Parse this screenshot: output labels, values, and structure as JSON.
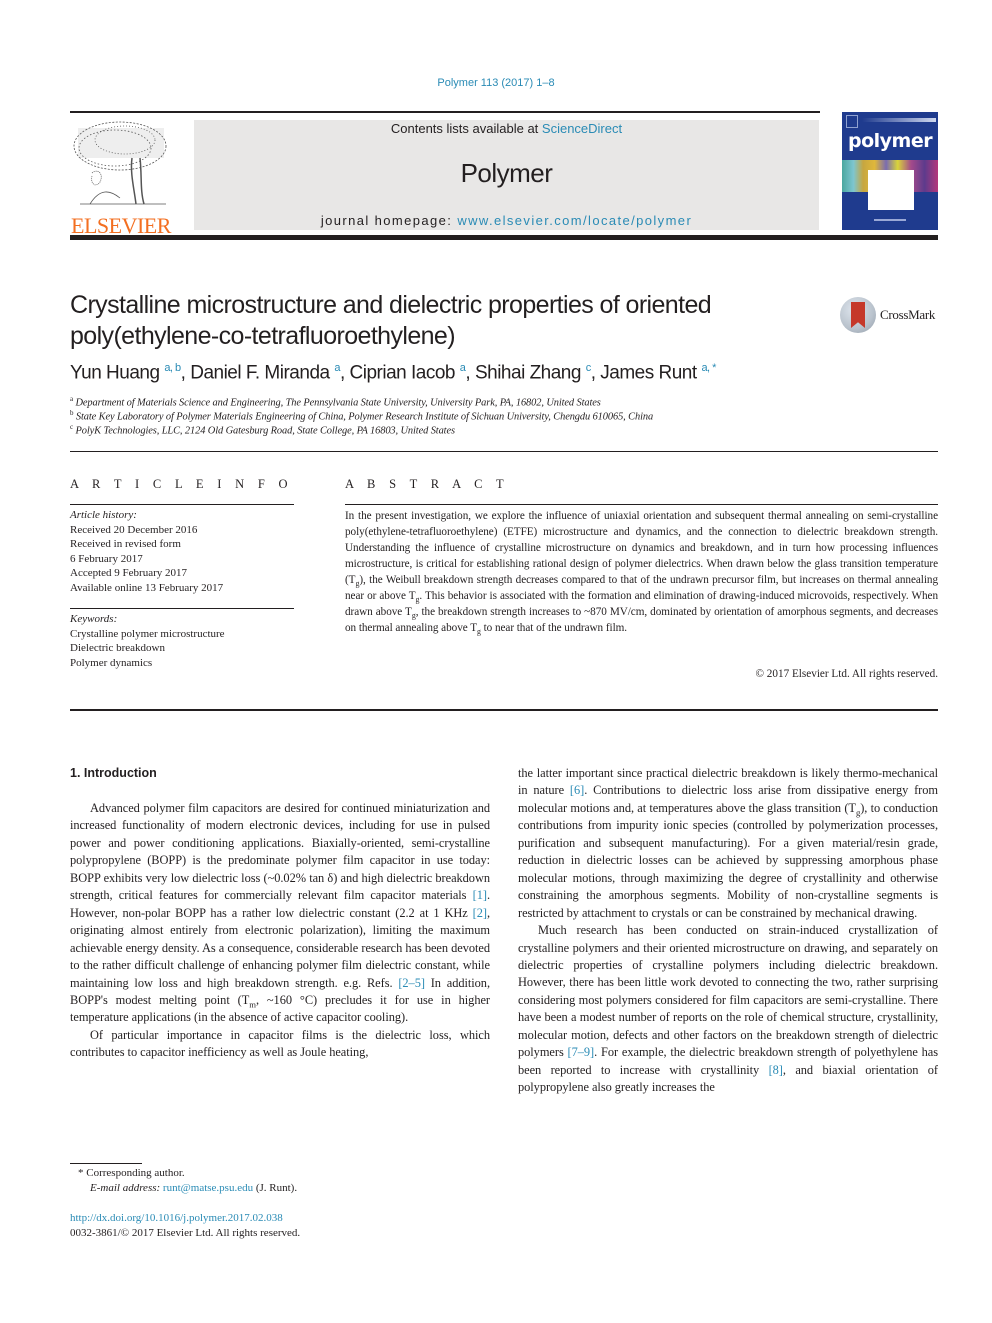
{
  "header": {
    "citation": "Polymer 113 (2017) 1–8",
    "contents_prefix": "Contents lists available at ",
    "contents_link": "ScienceDirect",
    "journal_name": "Polymer",
    "homepage_prefix": "journal homepage: ",
    "homepage_link": "www.elsevier.com/locate/polymer",
    "publisher_logo_text": "ELSEVIER",
    "cover_title": "polymer",
    "crossmark_label": "CrossMark",
    "colors": {
      "link": "#2a8bb5",
      "elsevier_orange": "#f36f21",
      "cover_blue": "#1f3b8e",
      "masthead_gray": "#e8e7e6"
    }
  },
  "article": {
    "title_line1": "Crystalline microstructure and dielectric properties of oriented",
    "title_line2": "poly(ethylene-co-tetrafluoroethylene)",
    "authors": [
      {
        "name": "Yun Huang",
        "sup": "a, b"
      },
      {
        "name": "Daniel F. Miranda",
        "sup": "a"
      },
      {
        "name": "Ciprian Iacob",
        "sup": "a"
      },
      {
        "name": "Shihai Zhang",
        "sup": "c"
      },
      {
        "name": "James Runt",
        "sup": "a, *"
      }
    ],
    "affiliations": [
      {
        "mark": "a",
        "text": "Department of Materials Science and Engineering, The Pennsylvania State University, University Park, PA, 16802, United States"
      },
      {
        "mark": "b",
        "text": "State Key Laboratory of Polymer Materials Engineering of China, Polymer Research Institute of Sichuan University, Chengdu 610065, China"
      },
      {
        "mark": "c",
        "text": "PolyK Technologies, LLC, 2124 Old Gatesburg Road, State College, PA 16803, United States"
      }
    ]
  },
  "article_info": {
    "heading": "A R T I C L E   I N F O",
    "history_label": "Article history:",
    "history": [
      "Received 20 December 2016",
      "Received in revised form",
      "6 February 2017",
      "Accepted 9 February 2017",
      "Available online 13 February 2017"
    ],
    "keywords_label": "Keywords:",
    "keywords": [
      "Crystalline polymer microstructure",
      "Dielectric breakdown",
      "Polymer dynamics"
    ]
  },
  "abstract": {
    "heading": "A B S T R A C T",
    "p1": "In the present investigation, we explore the influence of uniaxial orientation and subsequent thermal annealing on semi-crystalline poly(ethylene-tetrafluoroethylene) (ETFE) microstructure and dynamics, and the connection to dielectric breakdown strength. Understanding the influence of crystalline microstructure on dynamics and breakdown, and in turn how processing influences microstructure, is critical for establishing rational design of polymer dielectrics. When drawn below the glass transition temperature (T",
    "sub_g": "g",
    "p2": "), the Weibull breakdown strength decreases compared to that of the undrawn precursor film, but increases on thermal annealing near or above T",
    "p3": ". This behavior is associated with the formation and elimination of drawing-induced microvoids, respectively. When drawn above T",
    "p4": ", the breakdown strength increases to ~870 MV/cm, dominated by orientation of amorphous segments, and decreases on thermal annealing above T",
    "p5": " to near that of the undrawn film.",
    "copyright": "© 2017 Elsevier Ltd. All rights reserved."
  },
  "body": {
    "section_heading": "1.  Introduction",
    "left": {
      "p1_a": "Advanced polymer film capacitors are desired for continued miniaturization and increased functionality of modern electronic devices, including for use in pulsed power and power conditioning applications. Biaxially-oriented, semi-crystalline polypropylene (BOPP) is the predominate polymer film capacitor in use today: BOPP exhibits very low dielectric loss (~0.02% tan δ) and high dielectric breakdown strength, critical features for commercially relevant film capacitor materials ",
      "ref1": "[1]",
      "p1_b": ". However, non-polar BOPP has a rather low dielectric constant (2.2 at 1 KHz ",
      "ref2": "[2]",
      "p1_c": ", originating almost entirely from electronic polarization), limiting the maximum achievable energy density. As a consequence, considerable research has been devoted to the rather difficult challenge of enhancing polymer film dielectric constant, while maintaining low loss and high breakdown strength. e.g. Refs. ",
      "ref3": "[2–5]",
      "p1_d": " In addition, BOPP's modest melting point (T",
      "sub_m": "m",
      "p1_e": ", ~160 °C) precludes it for use in higher temperature applications (in the absence of active capacitor cooling).",
      "p2": "Of particular importance in capacitor films is the dielectric loss, which contributes to capacitor inefficiency as well as Joule heating,"
    },
    "right": {
      "p1_a": "the latter important since practical dielectric breakdown is likely thermo-mechanical in nature ",
      "ref6": "[6]",
      "p1_b": ". Contributions to dielectric loss arise from dissipative energy from molecular motions and, at temperatures above the glass transition (T",
      "sub_g": "g",
      "p1_c": "), to conduction contributions from impurity ionic species (controlled by polymerization processes, purification and subsequent manufacturing). For a given material/resin grade, reduction in dielectric losses can be achieved by suppressing amorphous phase molecular motions, through maximizing the degree of crystallinity and otherwise constraining the amorphous segments. Mobility of non-crystalline segments is restricted by attachment to crystals or can be constrained by mechanical drawing.",
      "p2_a": "Much research has been conducted on strain-induced crystallization of crystalline polymers and their oriented microstructure on drawing, and separately on dielectric properties of crystalline polymers including dielectric breakdown. However, there has been little work devoted to connecting the two, rather surprising considering most polymers considered for film capacitors are semi-crystalline. There have been a modest number of reports on the role of chemical structure, crystallinity, molecular motion, defects and other factors on the breakdown strength of dielectric polymers ",
      "ref7": "[7–9]",
      "p2_b": ". For example, the dielectric breakdown strength of polyethylene has been reported to increase with crystallinity ",
      "ref8": "[8]",
      "p2_c": ", and biaxial orientation of polypropylene also greatly increases the"
    }
  },
  "footnotes": {
    "corresponding": "*  Corresponding author.",
    "email_label": "E-mail address: ",
    "email": "runt@matse.psu.edu",
    "email_suffix": " (J. Runt).",
    "doi": "http://dx.doi.org/10.1016/j.polymer.2017.02.038",
    "issn": "0032-3861/© 2017 Elsevier Ltd. All rights reserved."
  }
}
